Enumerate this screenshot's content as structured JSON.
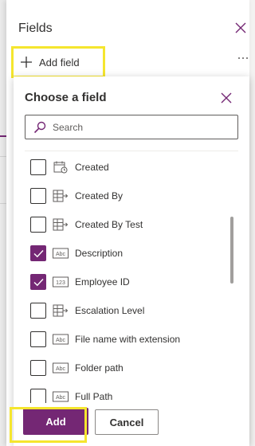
{
  "fields_panel": {
    "title": "Fields",
    "add_field_label": "Add field",
    "more_label": "···"
  },
  "choose_panel": {
    "title": "Choose a field",
    "search_placeholder": "Search",
    "items": [
      {
        "label": "Created",
        "icon": "calendar-clock-icon",
        "checked": false
      },
      {
        "label": "Created By",
        "icon": "lookup-table-icon",
        "checked": false
      },
      {
        "label": "Created By Test",
        "icon": "lookup-table-icon",
        "checked": false
      },
      {
        "label": "Description",
        "icon": "text-abc-icon",
        "checked": true
      },
      {
        "label": "Employee ID",
        "icon": "number-123-icon",
        "checked": true
      },
      {
        "label": "Escalation Level",
        "icon": "lookup-table-icon",
        "checked": false
      },
      {
        "label": "File name with extension",
        "icon": "text-abc-icon",
        "checked": false
      },
      {
        "label": "Folder path",
        "icon": "text-abc-icon",
        "checked": false
      },
      {
        "label": "Full Path",
        "icon": "text-abc-icon",
        "checked": false
      }
    ],
    "add_button_label": "Add",
    "cancel_button_label": "Cancel"
  },
  "colors": {
    "accent": "#742774",
    "highlight": "#f5e62e"
  }
}
